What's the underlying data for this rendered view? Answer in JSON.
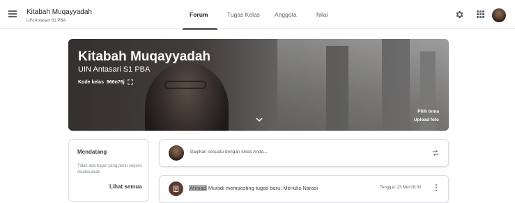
{
  "header": {
    "class_name": "Kitabah Muqayyadah",
    "class_section": "UIN Antasari S1 PBA",
    "tabs": [
      {
        "label": "Forum",
        "active": true
      },
      {
        "label": "Tugas Kelas",
        "active": false
      },
      {
        "label": "Anggota",
        "active": false
      },
      {
        "label": "Nilai",
        "active": false
      }
    ],
    "icons": [
      "menu-icon",
      "gear-icon",
      "apps-grid-icon",
      "avatar"
    ]
  },
  "banner": {
    "title": "Kitabah Muqayyadah",
    "subtitle": "UIN Antasari S1 PBA",
    "code_label": "Kode kelas",
    "code_value": "966n76j",
    "select_theme": "Pilih tema",
    "upload_photo": "Upload foto"
  },
  "upcoming": {
    "title": "Mendatang",
    "empty_text": "Tidak ada tugas yang perlu segera diselesaikan",
    "view_all": "Lihat semua"
  },
  "stream": {
    "share_placeholder": "Bagikan sesuatu dengan kelas Anda...",
    "post": {
      "author_highlight": "Ahmad",
      "text_rest": " Muradi memposting tugas baru: Menulis Narasi",
      "date": "Tenggat: 23 Mei 08.00"
    }
  },
  "colors": {
    "accent_tab": "#5f6368",
    "post_icon_bg": "#5b3a2f",
    "text_primary": "#3c4043"
  }
}
